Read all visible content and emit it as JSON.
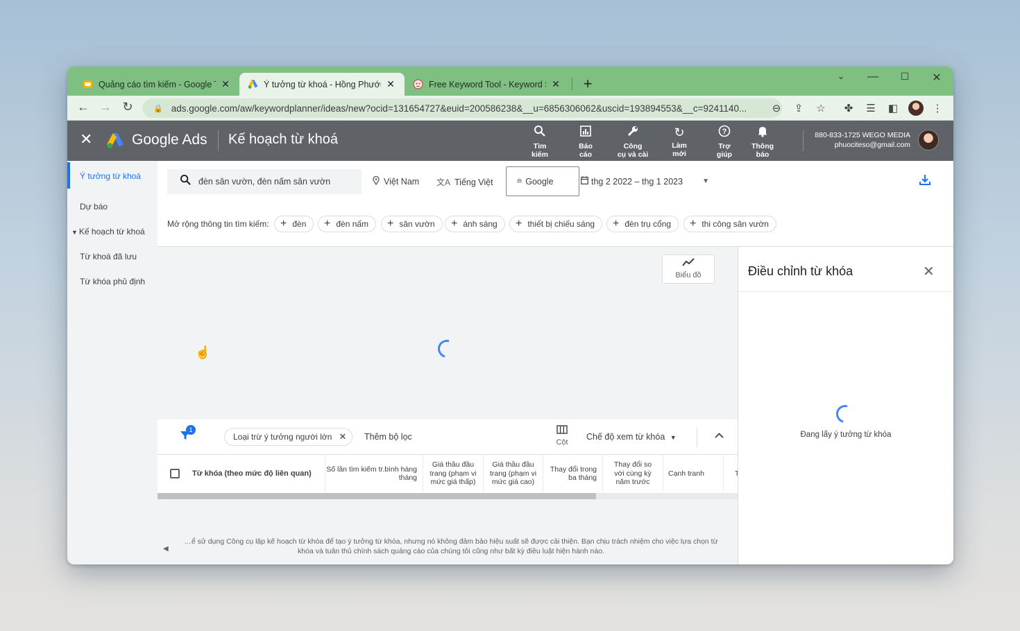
{
  "browser": {
    "tabs": [
      {
        "title": "Quảng cáo tìm kiếm - Google Tr",
        "active": false,
        "favicon": "slides-icon"
      },
      {
        "title": "Ý tưởng từ khoá - Hồng Phước A",
        "active": true,
        "favicon": "google-ads-icon"
      },
      {
        "title": "Free Keyword Tool - Keyword Sh",
        "active": false,
        "favicon": "keyword-shitter-icon"
      }
    ],
    "url": "ads.google.com/aw/keywordplanner/ideas/new?ocid=131654727&euid=200586238&__u=6856306062&uscid=193894553&__c=9241140..."
  },
  "ads_header": {
    "brand": "Google Ads",
    "page_title": "Kế hoạch từ khoá",
    "nav": [
      {
        "icon": "search-icon",
        "label1": "Tìm",
        "label2": "kiếm"
      },
      {
        "icon": "report-icon",
        "label1": "Báo",
        "label2": "cáo"
      },
      {
        "icon": "tools-icon",
        "label1": "Công",
        "label2": "cụ và cài"
      },
      {
        "icon": "refresh-icon",
        "label1": "Làm",
        "label2": "mới"
      },
      {
        "icon": "help-icon",
        "label1": "Trợ",
        "label2": "giúp"
      },
      {
        "icon": "bell-icon",
        "label1": "Thông",
        "label2": "báo"
      }
    ],
    "account_id": "880-833-1725 WEGO MEDIA",
    "account_email": "phuociteso@gmail.com"
  },
  "sidebar": {
    "items": [
      {
        "label": "Ý tưởng từ khoá",
        "active": true
      },
      {
        "label": "Dự báo",
        "active": false
      },
      {
        "label": "Kế hoạch từ khoá",
        "active": false,
        "expandable": true
      },
      {
        "label": "Từ khoá đã lưu",
        "active": false
      },
      {
        "label": "Từ khóa phủ định",
        "active": false
      }
    ]
  },
  "search": {
    "query": "đèn sân vườn, đèn nấm sân vườn",
    "location": "Việt Nam",
    "language": "Tiếng Việt",
    "network": "Google",
    "date_range": "thg 2 2022 – thg 1 2023"
  },
  "expand": {
    "label": "Mở rộng thông tin tìm kiếm:",
    "chips": [
      "đèn",
      "đèn nấm",
      "sân vườn",
      "ánh sáng",
      "thiết bị chiếu sáng",
      "đèn trụ cổng",
      "thi công sân vườn"
    ]
  },
  "chart": {
    "button_label": "Biểu đồ"
  },
  "filters": {
    "badge_count": "1",
    "exclude_chip": "Loại trừ ý tưởng người lớn",
    "add_filter": "Thêm bộ lọc",
    "columns_label": "Cột",
    "view_mode": "Chế độ xem từ khóa"
  },
  "table": {
    "columns": [
      "Từ khóa (theo mức độ liên quan)",
      "Số lần tìm kiếm tr.bình hàng tháng",
      "Giá thầu đầu trang (phạm vi mức giá thấp)",
      "Giá thầu đầu trang (phạm vi mức giá cao)",
      "Thay đổi trong ba tháng",
      "Thay đổi so với cùng kỳ năm trước",
      "Cạnh tranh",
      "T"
    ],
    "disclaimer_line1": "…ể sử dụng Công cụ lập kế hoạch từ khóa để tạo ý tưởng từ khóa, nhưng nó không đảm bảo hiệu suất sẽ được cải thiện. Bạn chịu trách nhiệm cho việc lựa chọn từ",
    "disclaimer_line2": "khóa và tuân thủ chính sách quảng cáo của chúng tôi cũng như bất kỳ điều luật hiện hành nào."
  },
  "right_panel": {
    "title": "Điều chỉnh từ khóa",
    "loading_text": "Đang lấy ý tưởng từ khóa"
  },
  "colors": {
    "tab_strip": "#7fbf82",
    "ads_header": "#5f6368",
    "accent_blue": "#1a73e8"
  }
}
